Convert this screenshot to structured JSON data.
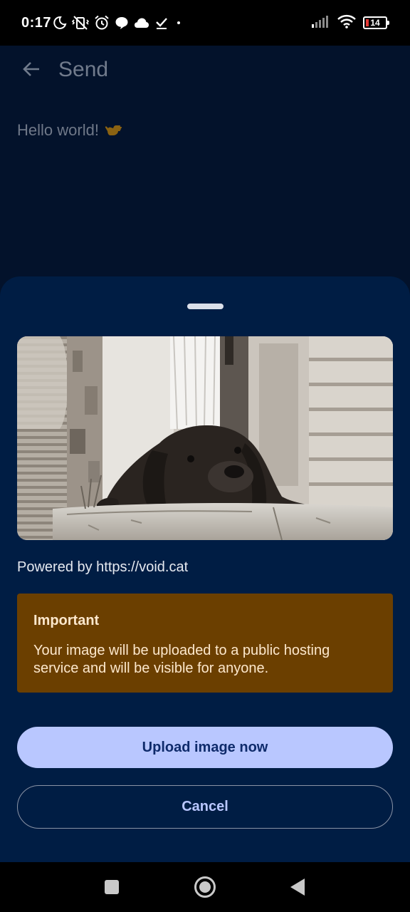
{
  "status_bar": {
    "time": "0:17",
    "battery_level": "14",
    "icons": [
      "do-not-disturb-moon-icon",
      "vibrate-off-icon",
      "alarm-icon",
      "chat-bubble-icon",
      "cloud-icon",
      "check-icon",
      "dot-icon",
      "signal-icon",
      "wifi-icon",
      "battery-icon"
    ]
  },
  "app_bar": {
    "title": "Send",
    "back_icon": "arrow-left-icon"
  },
  "message": {
    "text": "Hello world!",
    "emoji_icon": "call-me-hand-icon"
  },
  "sheet": {
    "image_alt": "black and white photo of a dog resting its head on a stone ledge",
    "powered_by": "Powered by https://void.cat",
    "notice": {
      "title": "Important",
      "body": "Your image will be uploaded to a public hosting service and will be visible for anyone."
    },
    "upload_label": "Upload image now",
    "cancel_label": "Cancel"
  },
  "nav_bar": {
    "icons": [
      "recents-square-icon",
      "home-circle-icon",
      "back-triangle-icon"
    ]
  },
  "colors": {
    "background": "#03122b",
    "sheet": "#001d44",
    "notice": "#6b3f00",
    "primary_button": "#b9c7ff",
    "primary_button_text": "#0f2b6b"
  }
}
